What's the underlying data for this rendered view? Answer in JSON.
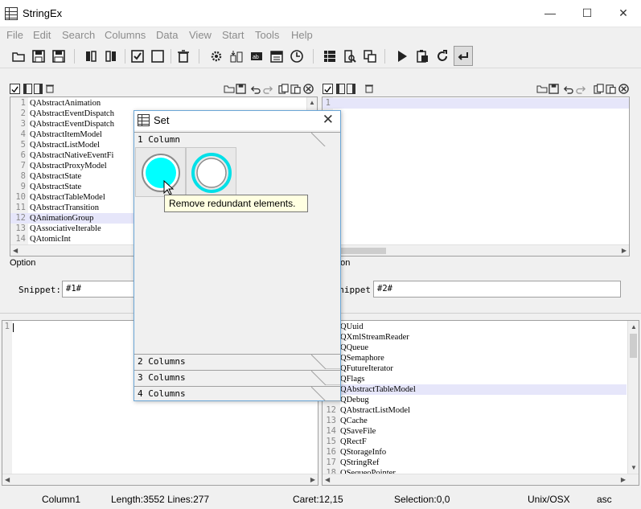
{
  "window": {
    "title": "StringEx",
    "minimize_glyph": "—",
    "maximize_glyph": "☐",
    "close_glyph": "✕"
  },
  "menu": [
    "File",
    "Edit",
    "Search",
    "Columns",
    "Data",
    "View",
    "Start",
    "Tools",
    "Help"
  ],
  "toolbar_icons": [
    "open-folder-icon",
    "save-icon",
    "save-all-icon",
    "columns-icon",
    "columns-alt-icon",
    "checkbox-checked-icon",
    "checkbox-empty-icon",
    "trash-icon",
    "gear-icon",
    "sort-icon",
    "ab-icon",
    "calendar-icon",
    "clock-icon",
    "grid-icon",
    "search-doc-icon",
    "copy-compare-icon",
    "play-icon",
    "paste-icon",
    "refresh-icon",
    "wrap-icon"
  ],
  "left_top": {
    "lines": [
      {
        "n": "1",
        "t": "QAbstractAnimation"
      },
      {
        "n": "2",
        "t": "QAbstractEventDispatch"
      },
      {
        "n": "3",
        "t": "QAbstractEventDispatch"
      },
      {
        "n": "4",
        "t": "QAbstractItemModel"
      },
      {
        "n": "5",
        "t": "QAbstractListModel"
      },
      {
        "n": "6",
        "t": "QAbstractNativeEventFi"
      },
      {
        "n": "7",
        "t": "QAbstractProxyModel"
      },
      {
        "n": "8",
        "t": "QAbstractState"
      },
      {
        "n": "9",
        "t": "QAbstractState"
      },
      {
        "n": "10",
        "t": "QAbstractTableModel"
      },
      {
        "n": "11",
        "t": "QAbstractTransition"
      },
      {
        "n": "12",
        "t": "QAnimationGroup"
      },
      {
        "n": "13",
        "t": "QAssociativeIterable"
      },
      {
        "n": "14",
        "t": "QAtomicInt"
      }
    ],
    "option_label": "Option",
    "snippet_label": "Snippet:",
    "snippet_value": "#1#"
  },
  "right_top": {
    "lines": [
      {
        "n": "1",
        "t": ""
      }
    ],
    "option_label": "Option",
    "snippet_label": "Snippet:",
    "snippet_value": "#2#"
  },
  "left_bottom": {
    "lines": [
      {
        "n": "1",
        "t": ""
      }
    ]
  },
  "right_bottom": {
    "lines": [
      {
        "n": "",
        "t": "QUuid"
      },
      {
        "n": "",
        "t": "QXmlStreamReader"
      },
      {
        "n": "",
        "t": "QQueue"
      },
      {
        "n": "",
        "t": "QSemaphore"
      },
      {
        "n": "",
        "t": "QFutureIterator"
      },
      {
        "n": "",
        "t": "QFlags"
      },
      {
        "n": "",
        "t": "QAbstractTableModel"
      },
      {
        "n": "",
        "t": "QDebug"
      },
      {
        "n": "12",
        "t": "QAbstractListModel"
      },
      {
        "n": "13",
        "t": "QCache"
      },
      {
        "n": "14",
        "t": "QSaveFile"
      },
      {
        "n": "15",
        "t": "QRectF"
      },
      {
        "n": "16",
        "t": "QStorageInfo"
      },
      {
        "n": "17",
        "t": "QStringRef"
      },
      {
        "n": "18",
        "t": "QSequeoPointer"
      }
    ]
  },
  "dialog": {
    "title": "Set",
    "close_glyph": "✕",
    "sections": [
      "1 Column",
      "2 Columns",
      "3 Columns",
      "4 Columns"
    ],
    "tooltip": "Remove redundant elements.",
    "accent": "#00ffff"
  },
  "status": {
    "column": "Column1",
    "length": "Length:3552 Lines:277",
    "caret": "Caret:12,15",
    "selection": "Selection:0,0",
    "eol": "Unix/OSX",
    "sort": "asc"
  }
}
